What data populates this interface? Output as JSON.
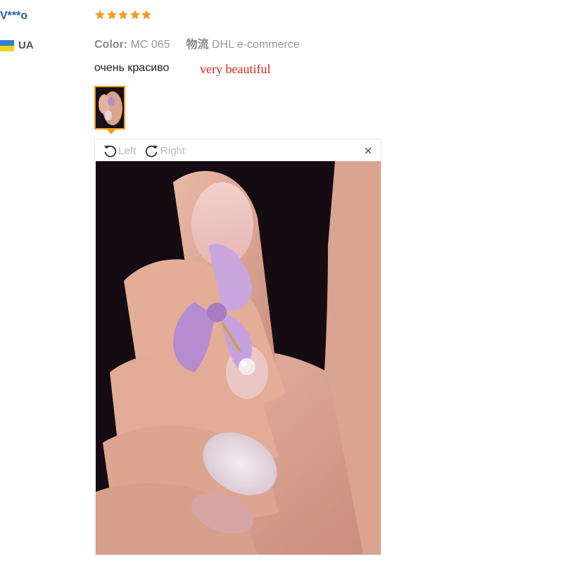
{
  "reviewer": {
    "username": "V***o",
    "country_code": "UA",
    "flag_colors": [
      "#2e7fd3",
      "#f5d21a"
    ]
  },
  "review": {
    "rating": 5,
    "star_color": "#f39a1e",
    "color_label": "Color:",
    "color_value": "MC 065",
    "logistics_label": "物流",
    "logistics_value": "DHL e-commerce",
    "text": "очень красиво",
    "translation": "very beautiful"
  },
  "photo_viewer": {
    "rotate_left_label": "Left",
    "rotate_right_label": "Right",
    "close_label": "×",
    "photo_icon": "nail-art-photo"
  }
}
